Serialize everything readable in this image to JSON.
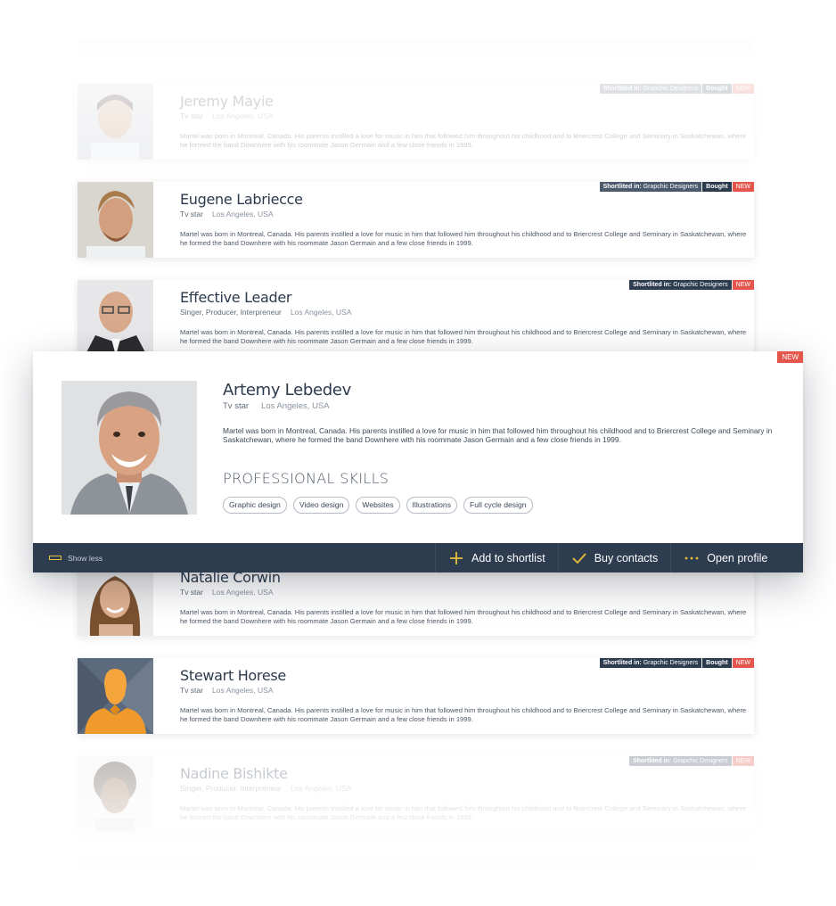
{
  "bio_text": "Martel was born in Montreal, Canada. His parents instilled a love for music in him that followed him throughout his childhood and to Briercrest College and Seminary in Saskatchewan, where he formed the band Downhere with his roommate Jason Germain and a few close friends in 1999.",
  "badge_labels": {
    "shortlisted_prefix": "Shortlited in:",
    "shortlisted_in": "Grapchic Designers",
    "bought": "Bought",
    "new": "NEW"
  },
  "cards": [
    {
      "name": "Jeremy Mayie",
      "role": "Tv star",
      "location": "Los Angeles, USA"
    },
    {
      "name": "Eugene Labriecce",
      "role": "Tv star",
      "location": "Los Angeles, USA"
    },
    {
      "name": "Effective Leader",
      "role": "Singer, Producer, Interpreneur",
      "location": "Los Angeles, USA"
    },
    {
      "name": "Natalie Corwin",
      "role": "Tv star",
      "location": "Los Angeles, USA"
    },
    {
      "name": "Stewart Horese",
      "role": "Tv star",
      "location": "Los Angeles, USA"
    },
    {
      "name": "Nadine Bishikte",
      "role": "Singer, Producer, Interpreneur",
      "location": "Los Angeles, USA"
    }
  ],
  "expanded": {
    "name": "Artemy Lebedev",
    "role": "Tv star",
    "location": "Los Angeles, USA",
    "new_label": "NEW",
    "skills_title": "PROFESSIONAL SKILLS",
    "skills": [
      "Graphic design",
      "Video design",
      "Websites",
      "Illustrations",
      "Full cycle design"
    ],
    "show_less": "Show less",
    "actions": {
      "add_to_shortlist": "Add to shortlist",
      "buy_contacts": "Buy contacts",
      "open_profile": "Open profile"
    }
  },
  "colors": {
    "navy": "#2e3c50",
    "badge_gray": "#4c5a6d",
    "badge_new": "#e4554b",
    "accent_yellow": "#e8c23a"
  },
  "icons": [
    "plus-icon",
    "checkmark-icon",
    "ellipsis-icon",
    "menu-lines-icon"
  ]
}
